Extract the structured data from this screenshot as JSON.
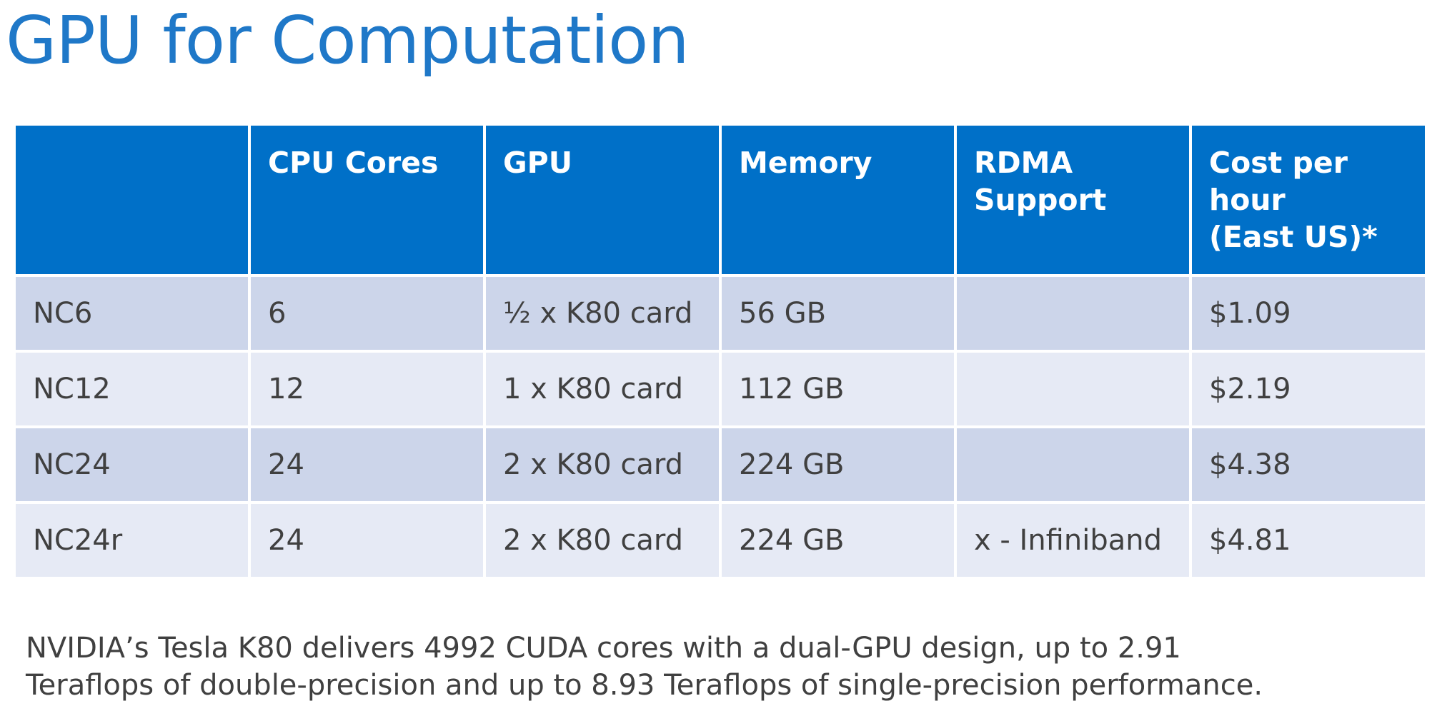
{
  "title": "GPU for Computation",
  "colors": {
    "title": "#1F78C8",
    "header_bg": "#0070C8",
    "row_dark": "#CCD5EA",
    "row_light": "#E6EAF5",
    "body_text": "#404040"
  },
  "table": {
    "headers": [
      {
        "lines": [
          ""
        ]
      },
      {
        "lines": [
          "CPU Cores"
        ]
      },
      {
        "lines": [
          "GPU"
        ]
      },
      {
        "lines": [
          "Memory"
        ]
      },
      {
        "lines": [
          "RDMA",
          "Support"
        ]
      },
      {
        "lines": [
          "Cost per",
          "hour",
          "(East US)*"
        ]
      }
    ],
    "rows": [
      [
        "NC6",
        "6",
        "½ x K80 card",
        "56 GB",
        "",
        "$1.09"
      ],
      [
        "NC12",
        "12",
        "1 x K80 card",
        "112 GB",
        "",
        "$2.19"
      ],
      [
        "NC24",
        "24",
        "2 x K80 card",
        "224 GB",
        "",
        "$4.38"
      ],
      [
        "NC24r",
        "24",
        "2 x K80 card",
        "224 GB",
        "x - Infiniband",
        "$4.81"
      ]
    ]
  },
  "footnote": {
    "lines": [
      "NVIDIA’s Tesla K80 delivers 4992 CUDA cores with a dual-GPU design, up to 2.91",
      "Teraflops of double-precision and up to 8.93 Teraflops of single-precision performance."
    ]
  }
}
